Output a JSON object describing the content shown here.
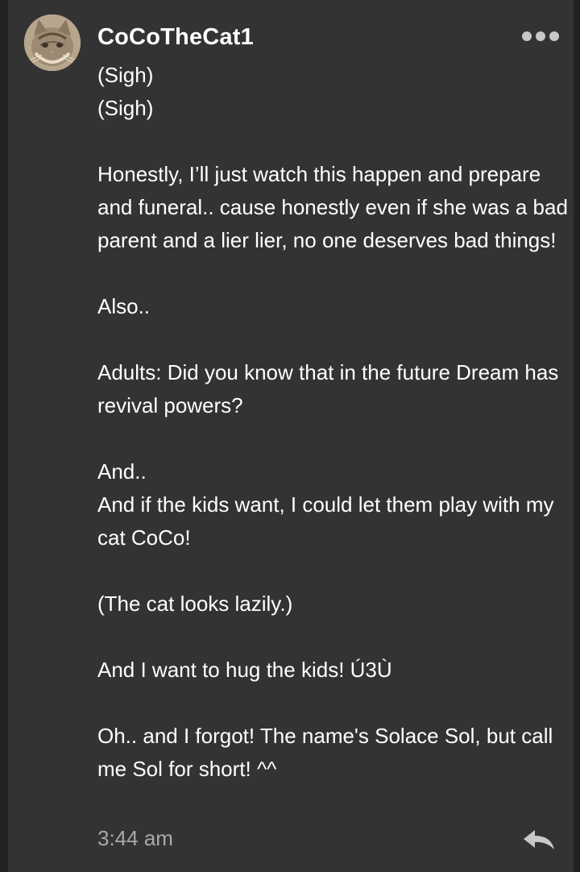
{
  "post": {
    "username": "CoCoTheCat1",
    "lines": [
      "(Sigh)",
      "(Sigh)",
      "",
      "Honestly, I’ll just watch this happen and prepare and funeral.. cause honestly even if she was a bad parent and a lier lier, no one deserves bad things!",
      "",
      "Also..",
      "",
      "Adults: Did you know that in the future Dream has revival powers?",
      "",
      "And..",
      "And if the kids want, I could let them play with my cat CoCo!",
      "",
      "(The cat looks lazily.)",
      "",
      "And I want to hug the kids! Ú3Ù",
      "",
      "Oh.. and I forgot! The name's Solace Sol, but call me Sol for short! ^^"
    ],
    "timestamp": "3:44 am"
  },
  "icons": {
    "avatar": "cat-avatar",
    "menu": "more-options-icon",
    "reply": "reply-arrow-icon"
  },
  "colors": {
    "background": "#333333",
    "text": "#ffffff",
    "muted": "#a9a9a9",
    "icon": "#c8c8c8"
  }
}
